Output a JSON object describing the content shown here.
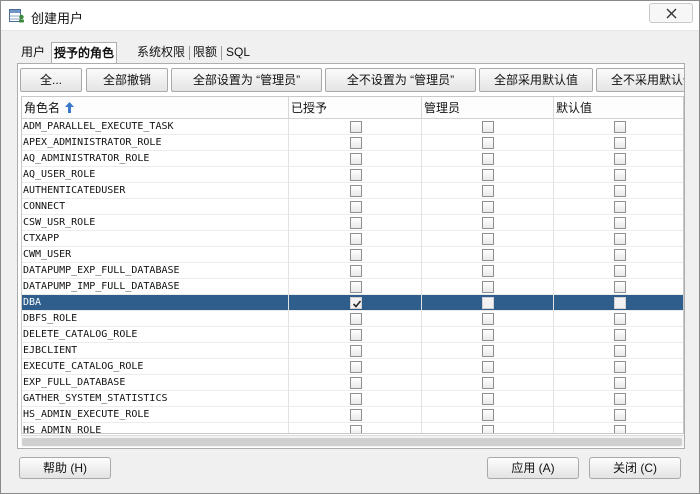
{
  "window": {
    "title": "创建用户",
    "app_icon": "table-user-icon",
    "close_icon": "close-icon"
  },
  "tabs": [
    {
      "label": "用户",
      "active": false
    },
    {
      "label": "授予的角色",
      "active": true
    },
    {
      "label": "系统权限",
      "active": false
    },
    {
      "label": "限额",
      "active": false
    },
    {
      "label": "SQL",
      "active": false
    }
  ],
  "toolbar": {
    "buttons": [
      {
        "label": "全..."
      },
      {
        "label": "全部撤销"
      },
      {
        "label": "全部设置为 “管理员”"
      },
      {
        "label": "全不设置为 “管理员”"
      },
      {
        "label": "全部采用默认值"
      },
      {
        "label": "全不采用默认值"
      }
    ]
  },
  "table": {
    "columns": [
      "角色名",
      "已授予",
      "管理员",
      "默认值"
    ],
    "sort_icon": "sort-ascending-icon",
    "rows": [
      {
        "name": "ADM_PARALLEL_EXECUTE_TASK",
        "granted": false,
        "admin": false,
        "default": false
      },
      {
        "name": "APEX_ADMINISTRATOR_ROLE",
        "granted": false,
        "admin": false,
        "default": false
      },
      {
        "name": "AQ_ADMINISTRATOR_ROLE",
        "granted": false,
        "admin": false,
        "default": false
      },
      {
        "name": "AQ_USER_ROLE",
        "granted": false,
        "admin": false,
        "default": false
      },
      {
        "name": "AUTHENTICATEDUSER",
        "granted": false,
        "admin": false,
        "default": false
      },
      {
        "name": "CONNECT",
        "granted": false,
        "admin": false,
        "default": false
      },
      {
        "name": "CSW_USR_ROLE",
        "granted": false,
        "admin": false,
        "default": false
      },
      {
        "name": "CTXAPP",
        "granted": false,
        "admin": false,
        "default": false
      },
      {
        "name": "CWM_USER",
        "granted": false,
        "admin": false,
        "default": false
      },
      {
        "name": "DATAPUMP_EXP_FULL_DATABASE",
        "granted": false,
        "admin": false,
        "default": false
      },
      {
        "name": "DATAPUMP_IMP_FULL_DATABASE",
        "granted": false,
        "admin": false,
        "default": false
      },
      {
        "name": "DBA",
        "granted": true,
        "admin": false,
        "default": false,
        "selected": true
      },
      {
        "name": "DBFS_ROLE",
        "granted": false,
        "admin": false,
        "default": false
      },
      {
        "name": "DELETE_CATALOG_ROLE",
        "granted": false,
        "admin": false,
        "default": false
      },
      {
        "name": "EJBCLIENT",
        "granted": false,
        "admin": false,
        "default": false
      },
      {
        "name": "EXECUTE_CATALOG_ROLE",
        "granted": false,
        "admin": false,
        "default": false
      },
      {
        "name": "EXP_FULL_DATABASE",
        "granted": false,
        "admin": false,
        "default": false
      },
      {
        "name": "GATHER_SYSTEM_STATISTICS",
        "granted": false,
        "admin": false,
        "default": false
      },
      {
        "name": "HS_ADMIN_EXECUTE_ROLE",
        "granted": false,
        "admin": false,
        "default": false
      },
      {
        "name": "HS_ADMIN_ROLE",
        "granted": false,
        "admin": false,
        "default": false
      }
    ]
  },
  "footer": {
    "help": "帮助 (H)",
    "apply": "应用 (A)",
    "close": "关闭 (C)"
  },
  "colors": {
    "selected_row": "#2f5e8c",
    "sort_arrow": "#3a78c9"
  }
}
